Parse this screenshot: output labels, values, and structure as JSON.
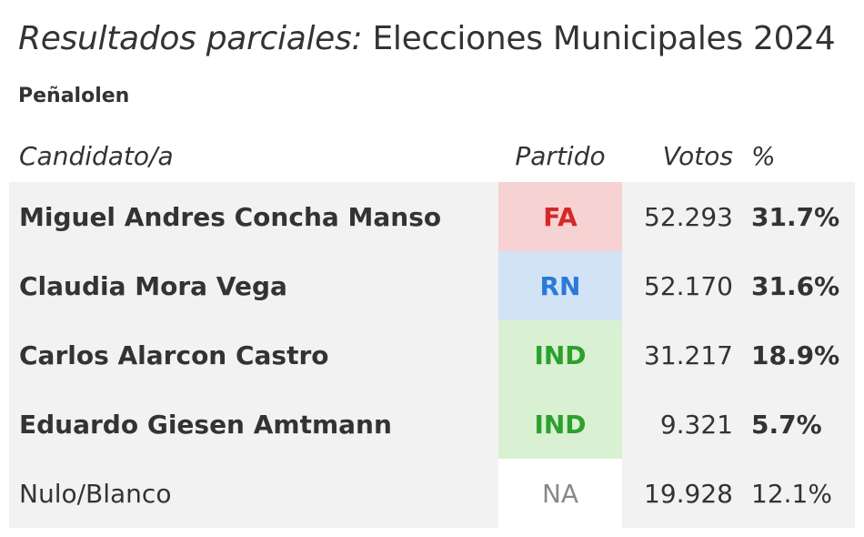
{
  "header": {
    "title_prefix": "Resultados parciales:",
    "title_main": " Elecciones Municipales 2024",
    "commune": "Peñalolen"
  },
  "columns": {
    "candidate": "Candidato/a",
    "party": "Partido",
    "votes": "Votos",
    "percent": "%"
  },
  "rows": [
    {
      "name": "Miguel Andres Concha Manso",
      "party": "FA",
      "votes": "52.293",
      "percent": "31.7%"
    },
    {
      "name": "Claudia Mora Vega",
      "party": "RN",
      "votes": "52.170",
      "percent": "31.6%"
    },
    {
      "name": "Carlos Alarcon Castro",
      "party": "IND",
      "votes": "31.217",
      "percent": "18.9%"
    },
    {
      "name": "Eduardo Giesen Amtmann",
      "party": "IND",
      "votes": "9.321",
      "percent": "5.7%"
    },
    {
      "name": "Nulo/Blanco",
      "party": "NA",
      "votes": "19.928",
      "percent": "12.1%"
    }
  ],
  "colors": {
    "FA": {
      "bg": "#f7d2d2",
      "fg": "#d62728"
    },
    "RN": {
      "bg": "#d3e3f6",
      "fg": "#2a7bd6"
    },
    "IND": {
      "bg": "#d9f0d3",
      "fg": "#2ca02c"
    },
    "NA": {
      "bg": "#ffffff",
      "fg": "#888888"
    },
    "row_background": "#f2f2f2",
    "text": "#333333"
  }
}
